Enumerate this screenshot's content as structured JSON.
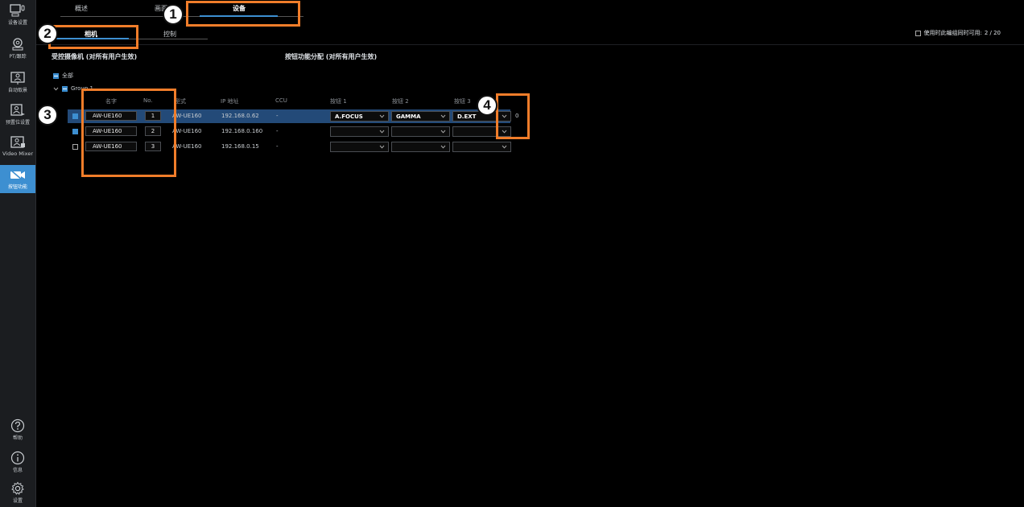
{
  "sidebar": {
    "items": [
      {
        "icon": "device-setting-icon",
        "label": "设备设置"
      },
      {
        "icon": "pt-tilt-icon",
        "label": "PT/跟踪"
      },
      {
        "icon": "auto-framing-icon",
        "label": "自动取景"
      },
      {
        "icon": "preset-icon",
        "label": "预置位设置"
      },
      {
        "icon": "video-mixer-icon",
        "label": "Video Mixer"
      },
      {
        "icon": "camera-control-icon",
        "label": "按钮功能"
      }
    ],
    "bottom": [
      {
        "icon": "help-icon",
        "label": "帮助"
      },
      {
        "icon": "info-icon",
        "label": "信息"
      },
      {
        "icon": "settings-icon",
        "label": "设置"
      }
    ]
  },
  "top_tabs": [
    "概述",
    "画面",
    "设备"
  ],
  "sub_tabs": [
    "相机",
    "控制"
  ],
  "status": {
    "label": "使用时此编组同时可用:",
    "value": "2 / 20"
  },
  "left_section_title": "受控摄像机 (对所有用户生效)",
  "right_section_title": "按钮功能分配 (对所有用户生效)",
  "tree": {
    "all_label": "全部",
    "group_label": "Group 1"
  },
  "table": {
    "headers": {
      "name": "名字",
      "no": "No.",
      "model": "型式",
      "ip": "IP 地址",
      "ccu": "CCU",
      "btn1": "按钮 1",
      "btn2": "按钮 2",
      "btn3": "按钮 3"
    },
    "rows": [
      {
        "checked": true,
        "name": "AW-UE160",
        "no": "1",
        "model": "AW-UE160",
        "ip": "192.168.0.62",
        "ccu": "-",
        "btn1": "A.FOCUS",
        "btn2": "GAMMA",
        "btn3": "D.EXT",
        "extra": "0",
        "selected": true
      },
      {
        "checked": true,
        "name": "AW-UE160",
        "no": "2",
        "model": "AW-UE160",
        "ip": "192.168.0.160",
        "ccu": "-",
        "btn1": "",
        "btn2": "",
        "btn3": "",
        "extra": "",
        "selected": false
      },
      {
        "checked": false,
        "name": "AW-UE160",
        "no": "3",
        "model": "AW-UE160",
        "ip": "192.168.0.15",
        "ccu": "-",
        "btn1": "",
        "btn2": "",
        "btn3": "",
        "extra": "",
        "selected": false
      }
    ]
  },
  "annotations": [
    "1",
    "2",
    "3",
    "4"
  ],
  "colors": {
    "accent": "#3d8fd1",
    "annotation": "#f07d2a",
    "selected_row": "#234a78",
    "background": "#000000"
  }
}
